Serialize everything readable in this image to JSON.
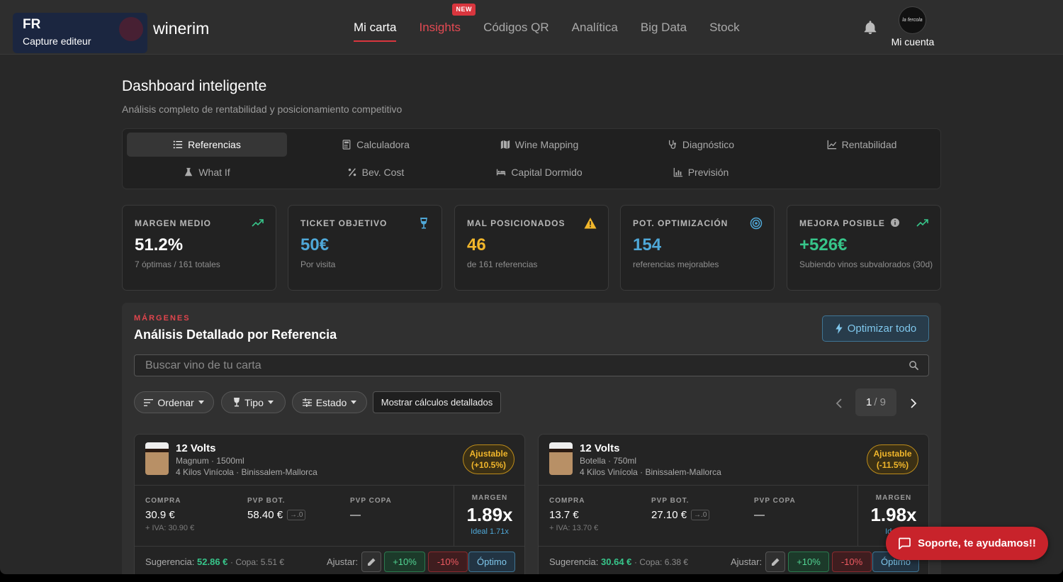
{
  "capture": {
    "lang": "FR",
    "label": "Capture editeur"
  },
  "brand": "winerim",
  "nav": {
    "items": [
      {
        "label": "Mi carta"
      },
      {
        "label": "Insights",
        "badge": "NEW"
      },
      {
        "label": "Códigos QR"
      },
      {
        "label": "Analítica"
      },
      {
        "label": "Big Data"
      },
      {
        "label": "Stock"
      }
    ],
    "active_index": 0
  },
  "account": {
    "label": "Mi cuenta",
    "avatar_text": "la fercola"
  },
  "page": {
    "title": "Dashboard inteligente",
    "subtitle": "Análisis completo de rentabilidad y posicionamiento competitivo"
  },
  "tabs": [
    {
      "label": "Referencias",
      "icon": "list-icon"
    },
    {
      "label": "Calculadora",
      "icon": "calculator-icon"
    },
    {
      "label": "Wine Mapping",
      "icon": "map-icon"
    },
    {
      "label": "Diagnóstico",
      "icon": "stethoscope-icon"
    },
    {
      "label": "Rentabilidad",
      "icon": "chart-line-icon"
    },
    {
      "label": "What If",
      "icon": "flask-icon"
    },
    {
      "label": "Bev. Cost",
      "icon": "percent-icon"
    },
    {
      "label": "Capital Dormido",
      "icon": "bed-icon"
    },
    {
      "label": "Previsión",
      "icon": "bar-chart-icon"
    }
  ],
  "stats": [
    {
      "label": "MARGEN MEDIO",
      "value": "51.2%",
      "sub": "7 óptimas / 161 totales",
      "color": "#ffffff",
      "icon": "trend-up-icon",
      "icon_color": "#37c58a"
    },
    {
      "label": "TICKET OBJETIVO",
      "value": "50€",
      "sub": "Por visita",
      "color": "#4fa8d8",
      "icon": "wine-glass-icon",
      "icon_color": "#4fa8d8"
    },
    {
      "label": "MAL POSICIONADOS",
      "value": "46",
      "sub": "de 161 referencias",
      "color": "#f1b62b",
      "icon": "warning-icon",
      "icon_color": "#f1b62b"
    },
    {
      "label": "POT. OPTIMIZACIÓN",
      "value": "154",
      "sub": "referencias mejorables",
      "color": "#4fa8d8",
      "icon": "target-icon",
      "icon_color": "#4fa8d8"
    },
    {
      "label": "MEJORA POSIBLE",
      "value": "+526€",
      "sub": "Subiendo vinos subvalorados (30d)",
      "color": "#37c58a",
      "icon": "trend-up-icon",
      "icon_color": "#37c58a"
    }
  ],
  "section": {
    "kicker": "MÁRGENES",
    "title": "Análisis Detallado por Referencia",
    "optimize_all": "Optimizar todo",
    "search_placeholder": "Buscar vino de tu carta",
    "filters": {
      "sort": "Ordenar",
      "type": "Tipo",
      "state": "Estado",
      "details": "Mostrar cálculos detallados"
    },
    "pager": {
      "current": "1",
      "total": "/ 9"
    }
  },
  "cards": [
    {
      "name": "12 Volts",
      "format": "Magnum · 1500ml",
      "producer": "4 Kilos Vinícola · Binissalem-Mallorca",
      "badge_line1": "Ajustable",
      "badge_line2": "(+10.5%)",
      "compra_label": "COMPRA",
      "compra": "30.9 €",
      "iva": "+ IVA: 30.90 €",
      "pvp_bot_label": "PVP BOT.",
      "pvp_bot": "58.40 €",
      "pvp_bot_btn": "→.0",
      "pvp_copa_label": "PVP COPA",
      "pvp_copa": "—",
      "margen_label": "MARGEN",
      "margen": "1.89x",
      "ideal": "Ideal 1.71x",
      "sug_label": "Sugerencia:",
      "sug_value": "52.86 €",
      "sug_copa": "· Copa: 5.51 €",
      "adjust_label": "Ajustar:",
      "btn_up": "+10%",
      "btn_down": "-10%",
      "btn_opt": "Óptimo"
    },
    {
      "name": "12 Volts",
      "format": "Botella · 750ml",
      "producer": "4 Kilos Vinícola · Binissalem-Mallorca",
      "badge_line1": "Ajustable",
      "badge_line2": "(-11.5%)",
      "compra_label": "COMPRA",
      "compra": "13.7 €",
      "iva": "+ IVA: 13.70 €",
      "pvp_bot_label": "PVP BOT.",
      "pvp_bot": "27.10 €",
      "pvp_bot_btn": "→.0",
      "pvp_copa_label": "PVP COPA",
      "pvp_copa": "—",
      "margen_label": "MARGEN",
      "margen": "1.98x",
      "ideal": "Ideal",
      "sug_label": "Sugerencia:",
      "sug_value": "30.64 €",
      "sug_copa": "· Copa: 6.38 €",
      "adjust_label": "Ajustar:",
      "btn_up": "+10%",
      "btn_down": "-10%",
      "btn_opt": "Óptimo"
    }
  ],
  "support": {
    "label": "Soporte, te ayudamos!!"
  }
}
